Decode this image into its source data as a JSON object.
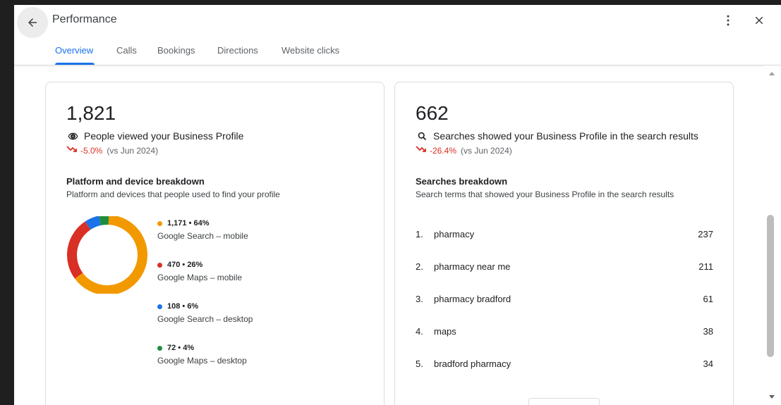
{
  "header": {
    "title": "Performance",
    "tabs": [
      {
        "label": "Overview",
        "active": true
      },
      {
        "label": "Calls",
        "active": false
      },
      {
        "label": "Bookings",
        "active": false
      },
      {
        "label": "Directions",
        "active": false
      },
      {
        "label": "Website clicks",
        "active": false
      }
    ],
    "icons": {
      "back": "arrow-back-icon",
      "more": "more-vert-icon",
      "close": "close-icon"
    }
  },
  "views_card": {
    "total": "1,821",
    "metric_label": "People viewed your Business Profile",
    "change": "-5.0%",
    "comparison": "(vs Jun 2024)",
    "section_title": "Platform and device breakdown",
    "section_subtitle": "Platform and devices that people used to find your profile",
    "breakdown": [
      {
        "value": "1,171 • 64%",
        "label": "Google Search – mobile",
        "color": "#f29900"
      },
      {
        "value": "470 • 26%",
        "label": "Google Maps – mobile",
        "color": "#d93025"
      },
      {
        "value": "108 • 6%",
        "label": "Google Search – desktop",
        "color": "#1a73e8"
      },
      {
        "value": "72 • 4%",
        "label": "Google Maps – desktop",
        "color": "#1e8e3e"
      }
    ]
  },
  "searches_card": {
    "total": "662",
    "metric_label": "Searches showed your Business Profile in the search results",
    "change": "-26.4%",
    "comparison": "(vs Jun 2024)",
    "section_title": "Searches breakdown",
    "section_subtitle": "Search terms that showed your Business Profile in the search results",
    "terms": [
      {
        "rank": "1.",
        "term": "pharmacy",
        "count": "237"
      },
      {
        "rank": "2.",
        "term": "pharmacy near me",
        "count": "211"
      },
      {
        "rank": "3.",
        "term": "pharmacy bradford",
        "count": "61"
      },
      {
        "rank": "4.",
        "term": "maps",
        "count": "38"
      },
      {
        "rank": "5.",
        "term": "bradford pharmacy",
        "count": "34"
      }
    ]
  },
  "chart_data": {
    "type": "pie",
    "categories": [
      "Google Search – mobile",
      "Google Maps – mobile",
      "Google Search – desktop",
      "Google Maps – desktop"
    ],
    "values": [
      1171,
      470,
      108,
      72
    ],
    "colors": [
      "#f29900",
      "#d93025",
      "#1a73e8",
      "#1e8e3e"
    ]
  }
}
